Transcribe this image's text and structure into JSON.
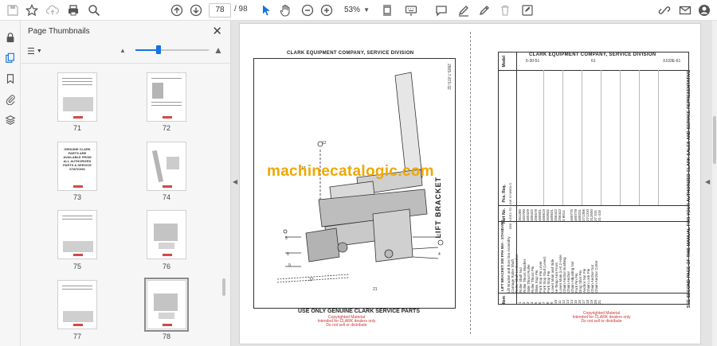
{
  "toolbar": {
    "page_current": "78",
    "page_total": "/ 98",
    "zoom": "53%"
  },
  "panel": {
    "title": "Page Thumbnails"
  },
  "thumbnails": [
    {
      "label": "71"
    },
    {
      "label": "72"
    },
    {
      "label": "73"
    },
    {
      "label": "74"
    },
    {
      "label": "75"
    },
    {
      "label": "76"
    },
    {
      "label": "77"
    },
    {
      "label": "78"
    }
  ],
  "thumb73_text": "GENUINE CLARK PARTS ARE AVAILABLE FROM ALL AUTHORIZED PARTS & SERVICE STATIONS",
  "document": {
    "left_header": "CLARK EQUIPMENT COMPANY, SERVICE DIVISION",
    "left_footer": "USE ONLY GENUINE CLARK SERVICE PARTS",
    "left_ref": "2805-7-870-32",
    "lift_label": "LIFT BRACKET",
    "right_header": "CLARK EQUIPMENT COMPANY, SERVICE DIVISION",
    "right_sub1": "6-30-51",
    "right_sub2": "61",
    "right_sub3": "X103E-61",
    "col_item": "Item",
    "col_part": "Part No.",
    "col_desc": "LIFT BRACKET 300 FFH 58A - STANDARD",
    "col_pcs": "Pcs. Req.",
    "col_pcs_extra": "SEE INDEX TO LINE SYMBOLS",
    "col_model": "Model",
    "descriptions": "Lift Bracket and Bore Bar Assembly\nCarriage Roller Shaft\nRoller Shaft Lockwasher\nRoller Shaft Nut\nRoller Thrust Washer\nSide Thrust Roller\nRoller Thrust Pin\nShim Stop Pin\nFork Stop Pin Lever\nFork Stop Stud (Lever)\nFork Stop Pin\nLower Main and Side\nHi-Temp Arm Front\nLower Main (LH) 2-Hole\nChain Anchor Bushing\nChain Anchor\nChain Adjusting Nut\nFork Pin Pin\nDrop Shot Pin\nAnchor Nut Pin\nChain Lock Pin\nChain Anchor Nut\nChain Anchor Cotter",
    "part_numbers": "261280\n263700\n460439\n460432\n256578\n460501\n460619\n263845\n460631\n256442\n256443\n3 8014\n\n460775\n460778\n460231\n271306\n271310\n313550\n37 315\n31-416",
    "item_numbers": "1\n2\n3\n4\n5\n6\n7\n8\n9\n10\n11\n12\n13\n14\n15\n16\n17\n18\n19\n20\n21",
    "side_note": "SEE SECOND PAGE OF THIS MANUAL FOR YOUR AUTHORIZED CLARK SALES AND SERVICE REPRESENTATIVE",
    "copyright1": "Copyrighted Material\nIntended for CLARK dealers only\nDo not sell or distribute",
    "copyright2": "Copyrighted Material\nIntended for CLARK dealers only\nDo not sell or distribute",
    "watermark": "machinecatalogic.com"
  }
}
